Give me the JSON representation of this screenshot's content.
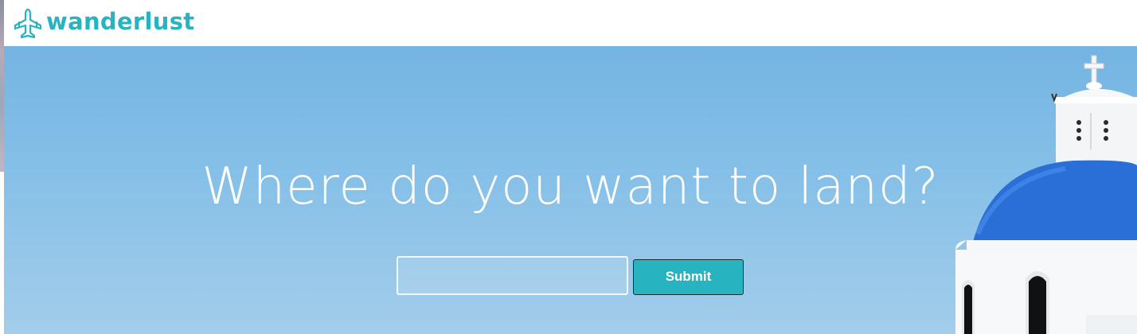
{
  "brand": {
    "name": "wanderlust",
    "icon": "airplane-icon",
    "color": "#27b3bf"
  },
  "hero": {
    "headline": "Where do you want to land?",
    "search": {
      "value": "",
      "placeholder": ""
    },
    "submit_label": "Submit",
    "background_image": "blue-dome-church-sky"
  },
  "colors": {
    "accent": "#27b3bf",
    "sky": "#7fbbe6",
    "dome": "#2a6fd8"
  }
}
